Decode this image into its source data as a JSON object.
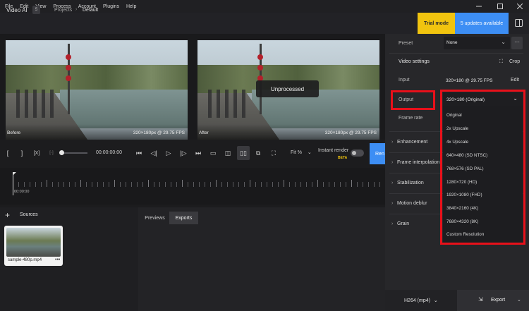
{
  "menu": [
    "File",
    "Edit",
    "View",
    "Process",
    "Account",
    "Plugins",
    "Help"
  ],
  "header": {
    "app_name": "Video AI",
    "badge": "5",
    "breadcrumb_root": "Projects",
    "breadcrumb_current": "Default",
    "trial_label": "Trial mode",
    "updates_label": "5 updates available"
  },
  "preview": {
    "before_label": "Before",
    "before_info": "320×180px @ 29.75 FPS",
    "after_label": "After",
    "after_info": "320×180px @ 29.75 FPS",
    "overlay": "Unprocessed"
  },
  "transport": {
    "time": "00:00:00:00",
    "fit_label": "Fit %",
    "instant_render": "Instant render",
    "beta": "BETA",
    "render_label": "Ren",
    "mark_in": "[",
    "mark_out": "]",
    "clear_marks": "[X]"
  },
  "timeline": {
    "start_time": "00:00:00"
  },
  "sources": {
    "title": "Sources",
    "files": [
      {
        "name": "sample-480p.mp4"
      }
    ]
  },
  "tabs": [
    "Previews",
    "Exports"
  ],
  "right_panel": {
    "preset_label": "Preset",
    "preset_value": "None",
    "video_settings": "Video settings",
    "crop_label": "Crop",
    "input_label": "Input",
    "input_value": "320×180 @ 29.75 FPS",
    "edit_label": "Edit",
    "output_label": "Output",
    "output_value": "320×180 (Original)",
    "frame_rate_label": "Frame rate",
    "sections": [
      "Enhancement",
      "Frame interpolation",
      "Stabilization",
      "Motion deblur",
      "Grain"
    ],
    "output_options": [
      "Original",
      "2x Upscale",
      "4x Upscale",
      "640×480 (SD NTSC)",
      "768×576 (SD PAL)",
      "1280×720 (HD)",
      "1920×1080 (FHD)",
      "3840×2160 (4K)",
      "7680×4320 (8K)",
      "Custom Resolution"
    ]
  },
  "footer": {
    "codec": "H264 (mp4)",
    "export_label": "Export"
  },
  "colors": {
    "trial": "#f1c40f",
    "accent": "#3d8ef4",
    "highlight": "#e8101a"
  }
}
